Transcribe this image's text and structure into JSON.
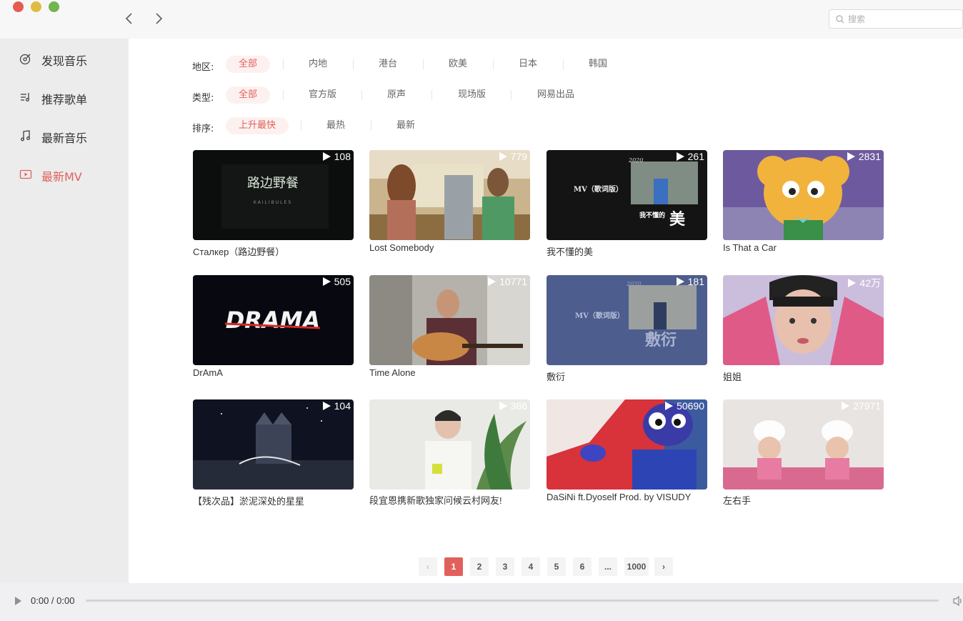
{
  "window": {
    "back_icon": "chevron-left-icon",
    "forward_icon": "chevron-right-icon"
  },
  "search": {
    "placeholder": "搜索"
  },
  "sidebar": {
    "items": [
      {
        "label": "发现音乐",
        "icon": "disc-icon"
      },
      {
        "label": "推荐歌单",
        "icon": "playlist-icon"
      },
      {
        "label": "最新音乐",
        "icon": "music-note-icon"
      },
      {
        "label": "最新MV",
        "icon": "video-icon",
        "active": true
      }
    ],
    "accent": "#e0615b"
  },
  "filters": {
    "area": {
      "label": "地区:",
      "options": [
        "全部",
        "内地",
        "港台",
        "欧美",
        "日本",
        "韩国"
      ],
      "selected": "全部"
    },
    "type": {
      "label": "类型:",
      "options": [
        "全部",
        "官方版",
        "原声",
        "现场版",
        "网易出品"
      ],
      "selected": "全部"
    },
    "order": {
      "label": "排序:",
      "options": [
        "上升最快",
        "最热",
        "最新"
      ],
      "selected": "上升最快"
    }
  },
  "mvs": [
    {
      "title": "Сталкер（路边野餐）",
      "plays": "108"
    },
    {
      "title": "Lost Somebody",
      "plays": "779"
    },
    {
      "title": "我不懂的美",
      "plays": "261"
    },
    {
      "title": "Is That a Car",
      "plays": "2831"
    },
    {
      "title": "DrAmA",
      "plays": "505"
    },
    {
      "title": "Time Alone",
      "plays": "10771"
    },
    {
      "title": "敷衍",
      "plays": "181"
    },
    {
      "title": "姐姐",
      "plays": "42万"
    },
    {
      "title": "【残次品】淤泥深处的星星",
      "plays": "104"
    },
    {
      "title": "段宜恩携新歌独家问候云村网友!",
      "plays": "386"
    },
    {
      "title": "DaSiNi ft.Dyoself Prod. by VISUDY",
      "plays": "50690"
    },
    {
      "title": "左右手",
      "plays": "27971"
    }
  ],
  "thumb_text": {
    "t0_main": "路边野餐",
    "t0_sub": "KAILIBULES",
    "t2_year": "2020",
    "t2_tag": "MV（歌词版）",
    "t2_line": "我不懂的",
    "t2_big": "美",
    "t4_word": "DRAMA",
    "t6_year": "2020",
    "t6_tag": "MV（歌词版）",
    "t6_big": "敷衍"
  },
  "pagination": {
    "prev": "‹",
    "pages": [
      "1",
      "2",
      "3",
      "4",
      "5",
      "6"
    ],
    "ellipsis": "...",
    "last": "1000",
    "next": "›",
    "current": "1"
  },
  "player": {
    "time": "0:00 / 0:00",
    "progress": 0
  }
}
